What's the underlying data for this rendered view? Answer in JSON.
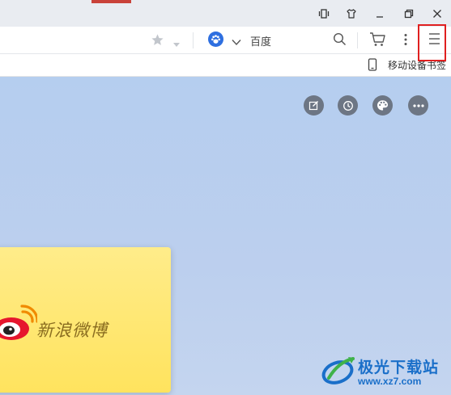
{
  "window": {
    "icons": [
      "layout-icon",
      "skin-icon",
      "minimize-icon",
      "restore-icon",
      "close-icon"
    ]
  },
  "toolbar": {
    "search_engine": "百度"
  },
  "bookmarks": {
    "mobile_label": "移动设备书签"
  },
  "newtab": {
    "tools": [
      "edit-icon",
      "history-icon",
      "palette-icon",
      "more-icon"
    ]
  },
  "card": {
    "brand_text": "新浪微博"
  },
  "watermark": {
    "name": "极光下载站",
    "url": "www.xz7.com"
  },
  "colors": {
    "highlight": "#e02020",
    "weibo_card": "#ffe35e",
    "background": "#b9d0f0"
  }
}
